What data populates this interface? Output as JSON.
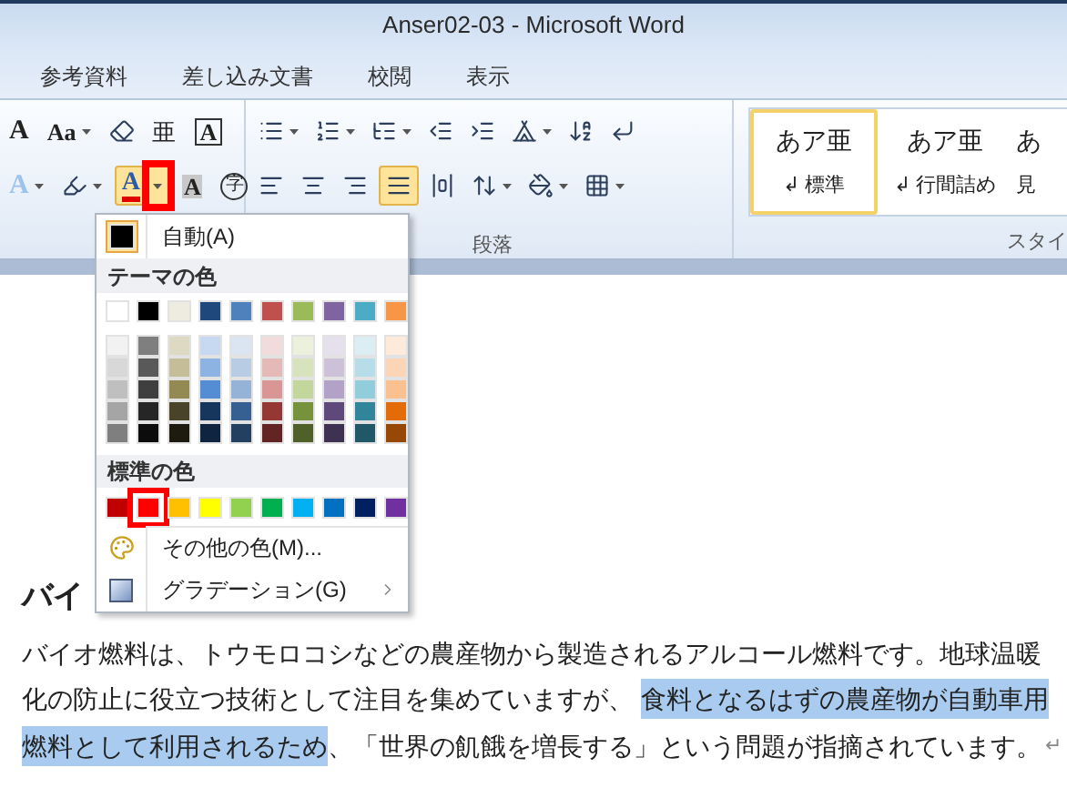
{
  "window": {
    "title": "Anser02-03 - Microsoft Word"
  },
  "tabs": [
    {
      "label": "参考資料",
      "selected": false
    },
    {
      "label": "差し込み文書",
      "selected": false
    },
    {
      "label": "校閲",
      "selected": false
    },
    {
      "label": "表示",
      "selected": false
    }
  ],
  "ribbon": {
    "font_group": {
      "rows": [
        [
          {
            "kind": "grow-font",
            "glyph": "A",
            "dropdown": false
          },
          {
            "kind": "change-case",
            "glyph": "Aa",
            "dropdown": true
          },
          {
            "kind": "clear-format",
            "dropdown": false
          },
          {
            "kind": "phonetic",
            "glyph": "亜",
            "dropdown": false
          },
          {
            "kind": "char-border",
            "glyph": "A",
            "dropdown": false
          }
        ],
        [
          {
            "kind": "text-effect",
            "glyph": "A",
            "dropdown": true
          },
          {
            "kind": "highlight",
            "dropdown": true
          },
          {
            "kind": "font-color",
            "glyph": "A",
            "dropdown": true,
            "selected": true,
            "highlighted": true
          },
          {
            "kind": "char-shading",
            "glyph": "A",
            "dropdown": false
          },
          {
            "kind": "enclose",
            "glyph": "字",
            "dropdown": false
          }
        ]
      ]
    },
    "paragraph_group": {
      "label": "段落",
      "rows": [
        [
          {
            "kind": "bullets",
            "dropdown": true,
            "selected": false
          },
          {
            "kind": "numbering",
            "dropdown": true,
            "selected": false
          },
          {
            "kind": "multilevel",
            "dropdown": true,
            "selected": false
          },
          {
            "kind": "outdent",
            "dropdown": false,
            "selected": false
          },
          {
            "kind": "indent",
            "dropdown": false,
            "selected": false
          },
          {
            "kind": "asian-layout",
            "dropdown": true,
            "selected": false
          },
          {
            "kind": "sort",
            "dropdown": false,
            "selected": false
          },
          {
            "kind": "show-marks",
            "dropdown": false,
            "selected": false
          }
        ],
        [
          {
            "kind": "align-left",
            "dropdown": false,
            "selected": false
          },
          {
            "kind": "align-center",
            "dropdown": false,
            "selected": false
          },
          {
            "kind": "align-right",
            "dropdown": false,
            "selected": false
          },
          {
            "kind": "justify",
            "dropdown": false,
            "selected": true
          },
          {
            "kind": "distributed",
            "dropdown": false,
            "selected": false
          },
          {
            "kind": "line-spacing",
            "dropdown": true,
            "selected": false
          },
          {
            "kind": "shading",
            "dropdown": true,
            "selected": false
          },
          {
            "kind": "borders",
            "dropdown": true,
            "selected": false
          }
        ]
      ]
    },
    "styles_group": {
      "label": "スタイ",
      "styles": [
        {
          "sample": "あア亜",
          "name": "↲ 標準",
          "selected": true
        },
        {
          "sample": "あア亜",
          "name": "↲ 行間詰め",
          "selected": false
        },
        {
          "sample": "あ",
          "name": "見",
          "selected": false
        }
      ]
    }
  },
  "color_menu": {
    "auto": {
      "label": "自動(A)",
      "color": "#000000"
    },
    "theme_header": "テーマの色",
    "theme_colors": [
      {
        "color": "#ffffff",
        "shades": [
          {
            "color": "#f2f2f2"
          },
          {
            "color": "#d8d8d8"
          },
          {
            "color": "#bfbfbf"
          },
          {
            "color": "#a5a5a5"
          },
          {
            "color": "#7f7f7f"
          }
        ]
      },
      {
        "color": "#000000",
        "shades": [
          {
            "color": "#7f7f7f"
          },
          {
            "color": "#595959"
          },
          {
            "color": "#3f3f3f"
          },
          {
            "color": "#262626"
          },
          {
            "color": "#0c0c0c"
          }
        ]
      },
      {
        "color": "#eeece1",
        "shades": [
          {
            "color": "#ddd9c3"
          },
          {
            "color": "#c4bd97"
          },
          {
            "color": "#938953"
          },
          {
            "color": "#494429"
          },
          {
            "color": "#1d1b10"
          }
        ]
      },
      {
        "color": "#1f497d",
        "shades": [
          {
            "color": "#c6d9f0"
          },
          {
            "color": "#8db3e2"
          },
          {
            "color": "#548dd4"
          },
          {
            "color": "#17365d"
          },
          {
            "color": "#0f243e"
          }
        ]
      },
      {
        "color": "#4f81bd",
        "shades": [
          {
            "color": "#dbe5f1"
          },
          {
            "color": "#b8cce4"
          },
          {
            "color": "#95b3d7"
          },
          {
            "color": "#366092"
          },
          {
            "color": "#244061"
          }
        ]
      },
      {
        "color": "#c0504d",
        "shades": [
          {
            "color": "#f2dcdb"
          },
          {
            "color": "#e5b9b7"
          },
          {
            "color": "#d99694"
          },
          {
            "color": "#953734"
          },
          {
            "color": "#632423"
          }
        ]
      },
      {
        "color": "#9bbb59",
        "shades": [
          {
            "color": "#ebf1dd"
          },
          {
            "color": "#d7e3bc"
          },
          {
            "color": "#c3d69b"
          },
          {
            "color": "#76923c"
          },
          {
            "color": "#4f6128"
          }
        ]
      },
      {
        "color": "#8064a2",
        "shades": [
          {
            "color": "#e5e0ec"
          },
          {
            "color": "#ccc1d9"
          },
          {
            "color": "#b2a2c7"
          },
          {
            "color": "#5f497a"
          },
          {
            "color": "#3f3151"
          }
        ]
      },
      {
        "color": "#4bacc6",
        "shades": [
          {
            "color": "#dbeef3"
          },
          {
            "color": "#b7dde8"
          },
          {
            "color": "#92cddc"
          },
          {
            "color": "#31859b"
          },
          {
            "color": "#205867"
          }
        ]
      },
      {
        "color": "#f79646",
        "shades": [
          {
            "color": "#fdeada"
          },
          {
            "color": "#fbd5b5"
          },
          {
            "color": "#fac08f"
          },
          {
            "color": "#e36c09"
          },
          {
            "color": "#974806"
          }
        ]
      }
    ],
    "standard_header": "標準の色",
    "standard_colors": [
      {
        "color": "#c00000",
        "highlighted": false
      },
      {
        "color": "#ff0000",
        "highlighted": true
      },
      {
        "color": "#ffc000",
        "highlighted": false
      },
      {
        "color": "#ffff00",
        "highlighted": false
      },
      {
        "color": "#92d050",
        "highlighted": false
      },
      {
        "color": "#00b050",
        "highlighted": false
      },
      {
        "color": "#00b0f0",
        "highlighted": false
      },
      {
        "color": "#0070c0",
        "highlighted": false
      },
      {
        "color": "#002060",
        "highlighted": false
      },
      {
        "color": "#7030a0",
        "highlighted": false
      }
    ],
    "more_colors": "その他の色(M)...",
    "gradient": "グラデーション(G)"
  },
  "document": {
    "heading": "バイ",
    "lines": [
      [
        {
          "text": "バイオ燃料は、トウモロコシなどの農産物から製造されるアルコール燃料です。地球温暖",
          "selected": false
        }
      ],
      [
        {
          "text": "化の防止に役立つ技術として注目を集めていますが、",
          "selected": false
        },
        {
          "text": "食料となるはずの農産物が自動車用",
          "selected": true
        }
      ],
      [
        {
          "text": "燃料として利用されるため",
          "selected": true
        },
        {
          "text": "、「世界の飢餓を増長する」という問題が指摘されています。",
          "selected": false
        }
      ]
    ],
    "paragraph_mark": "↵"
  }
}
